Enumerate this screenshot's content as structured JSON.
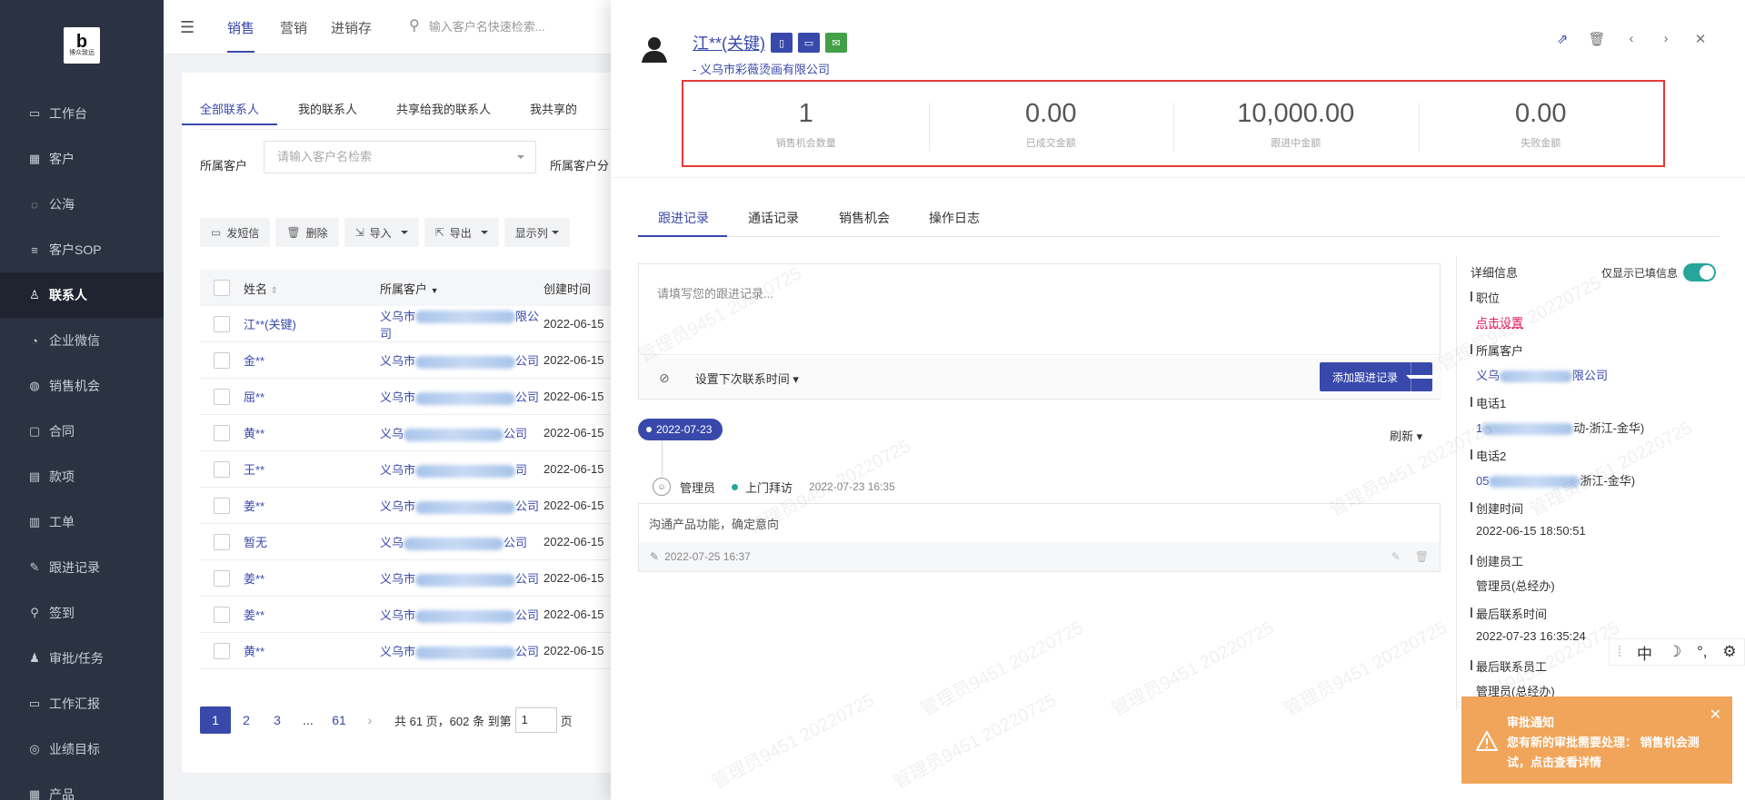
{
  "sidebar": {
    "logo_mark": "b",
    "logo_text": "博众致远",
    "items": [
      {
        "label": "工作台",
        "icon": "monitor-icon"
      },
      {
        "label": "客户",
        "icon": "building-icon"
      },
      {
        "label": "公海",
        "icon": "sea-icon"
      },
      {
        "label": "客户SOP",
        "icon": "sop-icon"
      },
      {
        "label": "联系人",
        "icon": "person-icon"
      },
      {
        "label": "企业微信",
        "icon": "chat-icon"
      },
      {
        "label": "销售机会",
        "icon": "money-bag-icon"
      },
      {
        "label": "合同",
        "icon": "contract-icon"
      },
      {
        "label": "款项",
        "icon": "payment-icon"
      },
      {
        "label": "工单",
        "icon": "ticket-icon"
      },
      {
        "label": "跟进记录",
        "icon": "edit-icon"
      },
      {
        "label": "签到",
        "icon": "checkin-icon"
      },
      {
        "label": "审批/任务",
        "icon": "approval-icon"
      },
      {
        "label": "工作汇报",
        "icon": "report-icon"
      },
      {
        "label": "业绩目标",
        "icon": "target-icon"
      },
      {
        "label": "产品",
        "icon": "product-icon"
      }
    ],
    "active_index": 4
  },
  "topbar": {
    "tabs": [
      "销售",
      "营销",
      "进销存"
    ],
    "search_placeholder": "输入客户名快速检索..."
  },
  "list": {
    "subtabs": [
      "全部联系人",
      "我的联系人",
      "共享给我的联系人",
      "我共享的"
    ],
    "filter_label": "所属客户",
    "filter_placeholder": "请输入客户名检索",
    "filter_label2": "所属客户分",
    "toolbar": [
      "发短信",
      "删除",
      "导入",
      "导出",
      "显示列"
    ],
    "headers": [
      "姓名",
      "所属客户",
      "创建时间"
    ],
    "rows": [
      {
        "name": "江**(关键)",
        "cust_prefix": "义乌市",
        "cust_suffix": "限公司",
        "time": "2022-06-15"
      },
      {
        "name": "金**",
        "cust_prefix": "义乌市",
        "cust_suffix": "公司",
        "time": "2022-06-15"
      },
      {
        "name": "屈**",
        "cust_prefix": "义乌市",
        "cust_suffix": "公司",
        "time": "2022-06-15"
      },
      {
        "name": "黄**",
        "cust_prefix": "义乌",
        "cust_suffix": "公司",
        "time": "2022-06-15"
      },
      {
        "name": "王**",
        "cust_prefix": "义乌市",
        "cust_suffix": "司",
        "time": "2022-06-15"
      },
      {
        "name": "姜**",
        "cust_prefix": "义乌市",
        "cust_suffix": "公司",
        "time": "2022-06-15"
      },
      {
        "name": "暂无",
        "cust_prefix": "义乌",
        "cust_suffix": "公司",
        "time": "2022-06-15"
      },
      {
        "name": "姜**",
        "cust_prefix": "义乌市",
        "cust_suffix": "公司",
        "time": "2022-06-15"
      },
      {
        "name": "姜**",
        "cust_prefix": "义乌市",
        "cust_suffix": "公司",
        "time": "2022-06-15"
      },
      {
        "name": "黄**",
        "cust_prefix": "义乌市",
        "cust_suffix": "公司",
        "time": "2022-06-15"
      }
    ],
    "pager": {
      "pages": [
        "1",
        "2",
        "3",
        "...",
        "61"
      ],
      "info": "共 61 页，602 条 到第",
      "goto_value": "1",
      "suffix": "页"
    }
  },
  "drawer": {
    "contact_name": "江**(关键)",
    "company": "- 义乌市彩薇烫画有限公司",
    "stats": [
      {
        "value": "1",
        "label": "销售机会数量"
      },
      {
        "value": "0.00",
        "label": "已成交金额"
      },
      {
        "value": "10,000.00",
        "label": "跟进中金额"
      },
      {
        "value": "0.00",
        "label": "失败金额"
      }
    ],
    "tabs": [
      "跟进记录",
      "通话记录",
      "销售机会",
      "操作日志"
    ],
    "composer_placeholder": "请填写您的跟进记录...",
    "next_time": "设置下次联系时间",
    "add_button": "添加跟进记录",
    "timeline_date": "2022-07-23",
    "refresh": "刷新",
    "entry": {
      "author": "管理员",
      "type": "上门拜访",
      "time": "2022-07-23 16:35",
      "text": "沟通产品功能，确定意向",
      "foot_time": "2022-07-25 16:37"
    },
    "details": {
      "title": "详细信息",
      "only_filled": "仅显示已填信息",
      "fields": [
        {
          "label": "职位",
          "value": "点击设置"
        },
        {
          "label": "所属客户",
          "value_prefix": "义乌",
          "value_suffix": "限公司"
        },
        {
          "label": "电话1",
          "value_prefix": "1",
          "value_suffix": "动-浙江-金华)"
        },
        {
          "label": "电话2",
          "value_prefix": "05",
          "value_suffix": "浙江-金华)"
        },
        {
          "label": "创建时间",
          "value": "2022-06-15 18:50:51"
        },
        {
          "label": "创建员工",
          "value": "管理员(总经办)"
        },
        {
          "label": "最后联系时间",
          "value": "2022-07-23 16:35:24"
        },
        {
          "label": "最后联系员工",
          "value": "管理员(总经办)"
        }
      ]
    }
  },
  "ime": {
    "items": [
      "中",
      "☽",
      "°,",
      "⚙"
    ]
  },
  "notice": {
    "title": "审批通知",
    "text": "您有新的审批需要处理： 销售机会测试，点击查看详情"
  },
  "watermark": "管理员9451 20220725",
  "colors": {
    "accent": "#3949ab",
    "sidebar": "#2b3241",
    "highlight": "#e53935",
    "notice": "#f0a55a",
    "toggle": "#26a69a"
  }
}
